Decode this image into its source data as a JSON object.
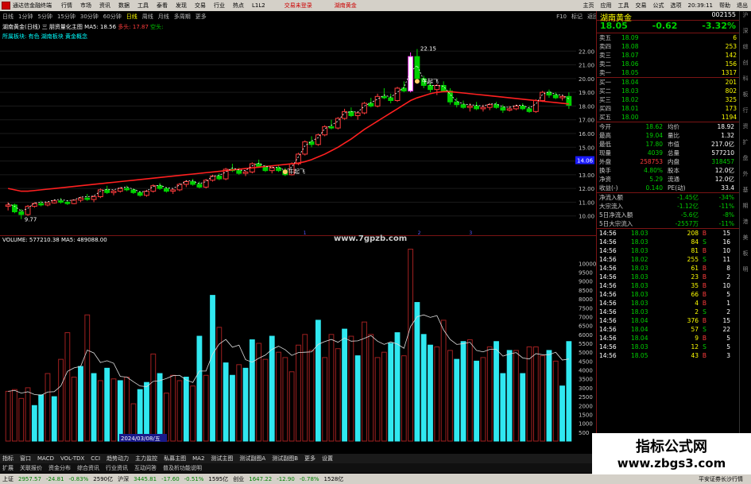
{
  "titlebar": {
    "app": "通达信金融终端",
    "menu": [
      "行情",
      "市场",
      "资讯",
      "数据",
      "工具",
      "泰看",
      "发现",
      "交易",
      "行业",
      "热点",
      "L1L2"
    ],
    "trade_alert": "交易未登录",
    "stock_name": "湖南黄金",
    "right": [
      "主页",
      "应用",
      "工具",
      "交易",
      "公式",
      "选项",
      "20:39:11",
      "帮助",
      "退出"
    ]
  },
  "toolbar": {
    "periods": [
      "日线",
      "1分钟",
      "5分钟",
      "15分钟",
      "30分钟",
      "60分钟",
      "日线",
      "周线",
      "月线",
      "多周期",
      "更多"
    ],
    "active_index": 6,
    "right": [
      "F10",
      "标记",
      "返回"
    ]
  },
  "main": {
    "title": "湖南黄金(日线)",
    "indicator": "三 朋资量化主图 MA5: 18.56",
    "signal_red": "多头: 17.87",
    "signal_green": "空头:",
    "subline": "所属板块: 有色 湖南板块 黄金概念",
    "hi_label": "22.15",
    "lo_label": "9.77",
    "mark_a": "牛起飞",
    "mark_b": "牛起飞",
    "price_marker": "14.06",
    "site": "www.7gpzb.com",
    "x_markers": [
      "1",
      "2",
      "3"
    ]
  },
  "vol": {
    "title": "VOLUME: 577210.38  MA5: 489088.00",
    "date_box": "2024/03/08/五"
  },
  "chart_data": {
    "type": "bar",
    "title": "湖南黄金(日线)",
    "ylim_price": [
      9,
      23
    ],
    "yticks_price": [
      "22.00",
      "21.00",
      "20.00",
      "19.00",
      "18.00",
      "17.00",
      "16.00",
      "15.00",
      "14.00",
      "13.00",
      "12.00",
      "11.00",
      "10.00"
    ],
    "ylim_vol": [
      0,
      11000
    ],
    "yticks_vol": [
      "10000",
      "9500",
      "9000",
      "8500",
      "8000",
      "7500",
      "7000",
      "6500",
      "6000",
      "5500",
      "5000",
      "4500",
      "4000",
      "3500",
      "3000",
      "2500",
      "2000",
      "1500",
      "1000",
      "500"
    ],
    "candles": [
      [
        10.7,
        11.0,
        10.4,
        10.8
      ],
      [
        10.8,
        10.9,
        10.2,
        10.3
      ],
      [
        10.3,
        10.5,
        9.77,
        10.1
      ],
      [
        10.1,
        10.8,
        10.0,
        10.7
      ],
      [
        10.7,
        11.0,
        10.6,
        10.9
      ],
      [
        10.9,
        11.1,
        10.7,
        10.8
      ],
      [
        10.8,
        11.0,
        10.7,
        10.95
      ],
      [
        10.95,
        11.2,
        10.9,
        11.1
      ],
      [
        11.1,
        11.3,
        10.9,
        11.0
      ],
      [
        11.0,
        11.1,
        10.8,
        10.9
      ],
      [
        10.9,
        11.2,
        10.85,
        11.15
      ],
      [
        11.15,
        11.4,
        11.0,
        11.3
      ],
      [
        11.3,
        11.6,
        11.1,
        11.2
      ],
      [
        11.2,
        11.5,
        11.0,
        11.4
      ],
      [
        11.4,
        12.0,
        11.3,
        11.9
      ],
      [
        11.9,
        12.2,
        11.6,
        11.7
      ],
      [
        11.7,
        11.9,
        11.5,
        11.8
      ],
      [
        11.8,
        12.1,
        11.7,
        12.0
      ],
      [
        12.0,
        12.2,
        11.8,
        11.9
      ],
      [
        11.9,
        12.0,
        11.6,
        11.7
      ],
      [
        11.7,
        11.8,
        11.4,
        11.5
      ],
      [
        11.5,
        11.9,
        11.4,
        11.8
      ],
      [
        11.8,
        12.3,
        11.7,
        12.2
      ],
      [
        12.2,
        12.4,
        11.9,
        12.0
      ],
      [
        12.0,
        12.1,
        11.7,
        11.8
      ],
      [
        11.8,
        12.0,
        11.6,
        11.9
      ],
      [
        11.9,
        12.4,
        11.8,
        12.3
      ],
      [
        12.3,
        12.6,
        12.1,
        12.5
      ],
      [
        12.5,
        12.7,
        12.2,
        12.3
      ],
      [
        12.3,
        12.5,
        12.0,
        12.1
      ],
      [
        12.1,
        12.7,
        12.0,
        12.6
      ],
      [
        12.6,
        13.0,
        12.5,
        12.9
      ],
      [
        12.9,
        13.1,
        12.6,
        12.7
      ],
      [
        12.7,
        13.5,
        12.6,
        13.4
      ],
      [
        13.4,
        13.8,
        13.2,
        13.3
      ],
      [
        13.3,
        13.5,
        13.0,
        13.1
      ],
      [
        13.1,
        13.3,
        12.9,
        13.2
      ],
      [
        13.2,
        13.9,
        13.1,
        13.8
      ],
      [
        13.8,
        14.1,
        13.5,
        13.6
      ],
      [
        13.6,
        13.7,
        13.2,
        13.3
      ],
      [
        13.3,
        13.6,
        13.1,
        13.5
      ],
      [
        13.5,
        13.7,
        13.2,
        13.3
      ],
      [
        13.3,
        13.5,
        12.9,
        13.0
      ],
      [
        13.0,
        13.9,
        12.95,
        13.8
      ],
      [
        13.8,
        14.6,
        13.7,
        14.5
      ],
      [
        14.5,
        15.5,
        14.4,
        15.4
      ],
      [
        15.4,
        15.8,
        15.0,
        15.2
      ],
      [
        15.2,
        16.0,
        15.1,
        15.9
      ],
      [
        15.9,
        16.6,
        15.8,
        16.5
      ],
      [
        16.5,
        17.0,
        16.3,
        16.4
      ],
      [
        16.4,
        17.2,
        16.3,
        17.1
      ],
      [
        17.1,
        17.8,
        17.0,
        17.6
      ],
      [
        17.6,
        17.9,
        17.2,
        17.3
      ],
      [
        17.3,
        17.6,
        17.0,
        17.5
      ],
      [
        17.5,
        18.3,
        17.4,
        18.2
      ],
      [
        18.2,
        18.6,
        17.9,
        18.0
      ],
      [
        18.0,
        18.9,
        17.9,
        18.7
      ],
      [
        18.7,
        19.3,
        18.5,
        18.6
      ],
      [
        18.6,
        18.9,
        18.2,
        18.4
      ],
      [
        18.4,
        19.4,
        18.3,
        19.3
      ],
      [
        19.3,
        19.8,
        19.0,
        19.1
      ],
      [
        19.1,
        21.9,
        19.0,
        21.6
      ],
      [
        21.6,
        22.15,
        19.7,
        20.0
      ],
      [
        20.0,
        20.2,
        19.3,
        19.5
      ],
      [
        19.5,
        19.7,
        19.0,
        19.2
      ],
      [
        19.2,
        19.6,
        18.8,
        19.5
      ],
      [
        19.5,
        19.8,
        19.0,
        19.1
      ],
      [
        19.1,
        19.3,
        18.1,
        18.3
      ],
      [
        18.3,
        18.6,
        17.9,
        18.1
      ],
      [
        18.1,
        18.4,
        17.8,
        17.9
      ],
      [
        17.9,
        18.2,
        17.6,
        18.0
      ],
      [
        18.0,
        18.3,
        17.7,
        17.8
      ],
      [
        17.8,
        18.1,
        17.6,
        17.9
      ],
      [
        17.9,
        18.2,
        17.7,
        18.1
      ],
      [
        18.1,
        18.3,
        17.8,
        17.9
      ],
      [
        17.9,
        18.1,
        17.5,
        17.7
      ],
      [
        17.7,
        18.0,
        17.6,
        17.8
      ],
      [
        17.8,
        18.1,
        17.7,
        18.0
      ],
      [
        18.0,
        18.2,
        17.7,
        17.8
      ],
      [
        17.8,
        18.0,
        17.5,
        17.6
      ],
      [
        17.6,
        18.5,
        17.5,
        18.4
      ],
      [
        18.4,
        19.1,
        18.3,
        19.0
      ],
      [
        19.0,
        19.2,
        18.6,
        18.8
      ],
      [
        18.8,
        19.0,
        18.5,
        18.6
      ],
      [
        18.6,
        18.8,
        18.4,
        18.7
      ],
      [
        18.7,
        19.0,
        17.8,
        18.05
      ]
    ],
    "vol_colors": "rrrrccrcrrrcrcrcrcrrccrcrrrcrcrcrccrccrrcrrrrrrcrrrcrcrrrrccrrcccrrrccrcrrcccrcrrrcrccc",
    "volumes": [
      2800,
      2900,
      2400,
      3000,
      2000,
      2600,
      3800,
      2500,
      4600,
      6100,
      3600,
      4200,
      7100,
      3800,
      3400,
      4100,
      3500,
      3400,
      3600,
      2100,
      2900,
      3300,
      4900,
      3800,
      2700,
      3700,
      3400,
      3600,
      3100,
      5900,
      3700,
      8200,
      6400,
      4400,
      3700,
      4300,
      4100,
      5700,
      5500,
      4600,
      5900,
      5000,
      4700,
      3900,
      5400,
      6000,
      5100,
      6800,
      4700,
      6000,
      5200,
      6300,
      5900,
      4800,
      6700,
      6000,
      4700,
      5000,
      5500,
      6100,
      4800,
      10800,
      7800,
      6000,
      5400,
      5300,
      6800,
      5100,
      4600,
      5600,
      5700,
      4500,
      4700,
      5300,
      5600,
      3800,
      5100,
      5100,
      3800,
      5300,
      5300,
      4800,
      5100,
      4500,
      3100,
      5600
    ],
    "ma5": [
      12.0,
      11.9,
      11.8,
      11.8,
      11.85,
      11.9,
      11.95,
      12.0,
      12.05,
      12.1,
      12.15,
      12.2,
      12.25,
      12.3,
      12.35,
      12.4,
      12.45,
      12.5,
      12.55,
      12.6,
      12.65,
      12.7,
      12.75,
      12.8,
      12.85,
      12.9,
      12.95,
      13.0,
      13.05,
      13.1,
      13.15,
      13.2,
      13.25,
      13.3,
      13.35,
      13.4,
      13.45,
      13.5,
      13.55,
      13.6,
      13.65,
      13.7,
      13.75,
      13.8,
      13.85,
      13.95,
      14.1,
      14.3,
      14.5,
      14.75,
      15.0,
      15.3,
      15.6,
      15.95,
      16.3,
      16.6,
      16.9,
      17.2,
      17.5,
      17.8,
      18.1,
      18.4,
      18.6,
      18.75,
      18.9,
      19.0,
      19.05,
      19.05,
      19.0,
      18.95,
      18.9,
      18.85,
      18.8,
      18.75,
      18.7,
      18.65,
      18.6,
      18.55,
      18.5,
      18.45,
      18.4,
      18.35,
      18.3,
      18.25,
      18.2,
      18.15
    ]
  },
  "side": {
    "name": "湖南黄金",
    "code": "002155",
    "price": "18.05",
    "chg": "-0.62",
    "pct": "-3.32%",
    "asks": [
      [
        "卖五",
        "18.09",
        "6"
      ],
      [
        "卖四",
        "18.08",
        "253"
      ],
      [
        "卖三",
        "18.07",
        "142"
      ],
      [
        "卖二",
        "18.06",
        "156"
      ],
      [
        "卖一",
        "18.05",
        "1317"
      ]
    ],
    "bids": [
      [
        "买一",
        "18.04",
        "201"
      ],
      [
        "买二",
        "18.03",
        "802"
      ],
      [
        "买三",
        "18.02",
        "325"
      ],
      [
        "买四",
        "18.01",
        "173"
      ],
      [
        "买五",
        "18.00",
        "1194"
      ]
    ],
    "quote": [
      [
        "今开",
        "18.62",
        "均价",
        "18.92"
      ],
      [
        "最高",
        "19.04",
        "量比",
        "1.32"
      ],
      [
        "最低",
        "17.80",
        "市值",
        "217.0亿"
      ],
      [
        "现量",
        "4039",
        "总量",
        "577210"
      ],
      [
        "外盘",
        "258753",
        "内盘",
        "318457"
      ],
      [
        "换手",
        "4.80%",
        "股本",
        "12.0亿"
      ],
      [
        "净资",
        "5.29",
        "流通",
        "12.0亿"
      ],
      [
        "收益(-)",
        "0.140",
        "PE(动)",
        "33.4"
      ]
    ],
    "flows": [
      [
        "净流入额",
        "-1.45亿",
        "-34%"
      ],
      [
        "大宗流入",
        "-1.12亿",
        "-11%"
      ],
      [
        "5日净流入额",
        "-5.6亿",
        "-8%"
      ],
      [
        "5日大宗流入",
        "-2557万",
        "-11%"
      ]
    ],
    "ticks": [
      [
        "14:56",
        "18.03",
        "208",
        "B",
        "15"
      ],
      [
        "14:56",
        "18.03",
        "84",
        "S",
        "16"
      ],
      [
        "14:56",
        "18.03",
        "81",
        "B",
        "10"
      ],
      [
        "14:56",
        "18.02",
        "255",
        "S",
        "11"
      ],
      [
        "14:56",
        "18.03",
        "61",
        "B",
        "8"
      ],
      [
        "14:56",
        "18.03",
        "23",
        "B",
        "2"
      ],
      [
        "14:56",
        "18.03",
        "35",
        "B",
        "10"
      ],
      [
        "14:56",
        "18.03",
        "66",
        "B",
        "5"
      ],
      [
        "14:56",
        "18.03",
        "4",
        "B",
        "1"
      ],
      [
        "14:56",
        "18.03",
        "2",
        "S",
        "2"
      ],
      [
        "14:56",
        "18.04",
        "376",
        "B",
        "15"
      ],
      [
        "14:56",
        "18.04",
        "57",
        "S",
        "22"
      ],
      [
        "14:56",
        "18.04",
        "9",
        "B",
        "5"
      ],
      [
        "14:56",
        "18.03",
        "12",
        "S",
        "5"
      ],
      [
        "14:56",
        "18.05",
        "43",
        "B",
        "3"
      ]
    ]
  },
  "rstrip": [
    "沪",
    "深",
    "综",
    "创",
    "科",
    "板",
    "行",
    "资",
    "扩",
    "盘",
    "外",
    "基",
    "期",
    "港",
    "美",
    "板",
    "明"
  ],
  "tabs": [
    "指标",
    "窗口",
    "MACD",
    "VOL-TDX",
    "CCI",
    "趋势动力",
    "主力监控",
    "私募主图",
    "MA2",
    "测试主图",
    "测试副图A",
    "测试副图B",
    "更多",
    "设置"
  ],
  "tabs2": [
    "扩展",
    "关联报价",
    "资金分布",
    "综合资讯",
    "行业资讯",
    "互动问答",
    "普及析功能说明"
  ],
  "status": [
    [
      "上证",
      "2957.57",
      "-24.81",
      "-0.83%",
      "2590亿"
    ],
    [
      "沪深",
      "3445.81",
      "-17.60",
      "-0.51%",
      "1595亿"
    ],
    [
      "创业",
      "1647.22",
      "-12.90",
      "-0.78%",
      "1528亿"
    ]
  ],
  "status_right": "平安证券长沙行情",
  "watermark": {
    "a": "指标公式网",
    "b": "www.zbgs3.com"
  },
  "colors": {
    "up": "#ff3c3c",
    "down": "#00d000",
    "ma": "#ff2020",
    "ma5": "#ffffff",
    "cyan": "#00ffff",
    "vol_red": "#6e1414",
    "vol_cyan": "#30e8f0"
  }
}
